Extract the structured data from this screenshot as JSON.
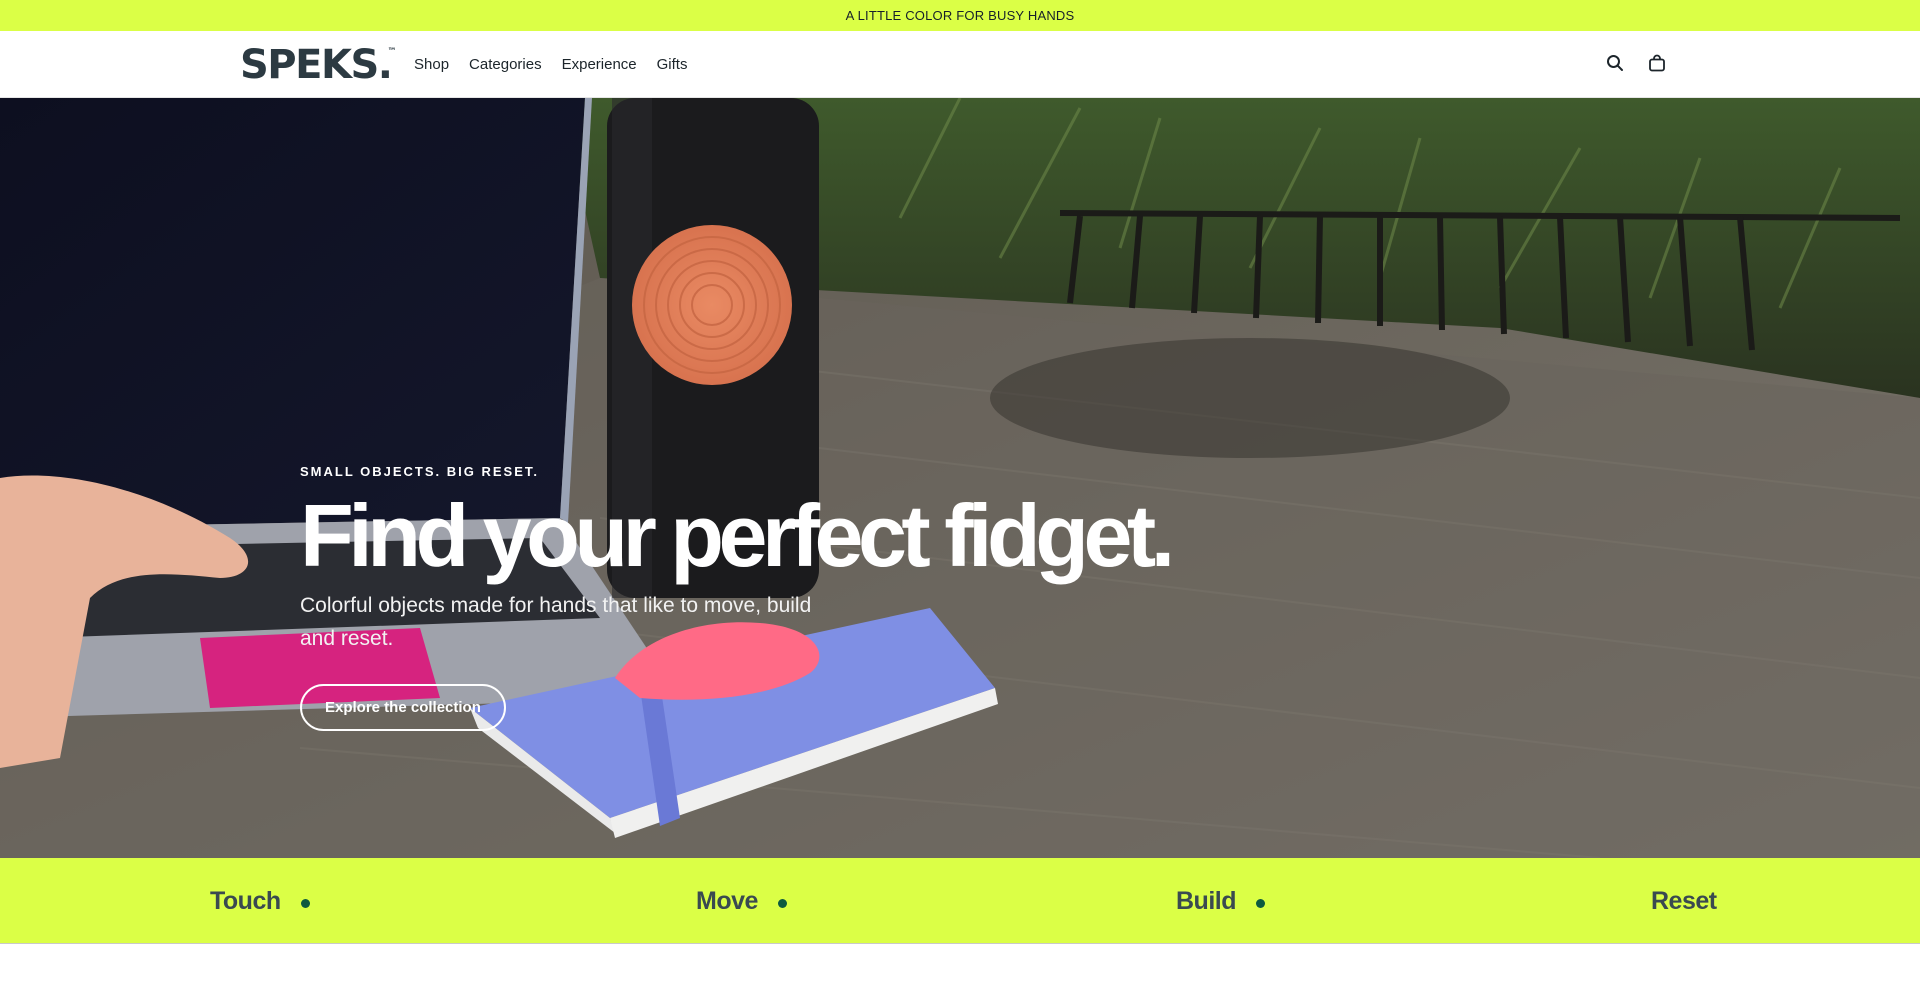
{
  "announcement": {
    "text": "A LITTLE COLOR FOR BUSY HANDS"
  },
  "header": {
    "logo": "SPEKS.",
    "logo_mark": "™",
    "nav": [
      {
        "label": "Shop"
      },
      {
        "label": "Categories"
      },
      {
        "label": "Experience"
      },
      {
        "label": "Gifts"
      }
    ],
    "icons": [
      "search-icon",
      "bag-icon"
    ]
  },
  "hero": {
    "eyebrow": "SMALL OBJECTS. BIG RESET.",
    "headline": "Find your perfect fidget.",
    "subhead": "Colorful objects made for hands that like to move, build and reset.",
    "cta": "Explore the collection"
  },
  "strip": {
    "items": [
      {
        "label": "Touch"
      },
      {
        "label": "Move"
      },
      {
        "label": "Build"
      },
      {
        "label": "Reset"
      }
    ],
    "accent": "#dbff46",
    "dot_color": "#0d5a3f"
  }
}
